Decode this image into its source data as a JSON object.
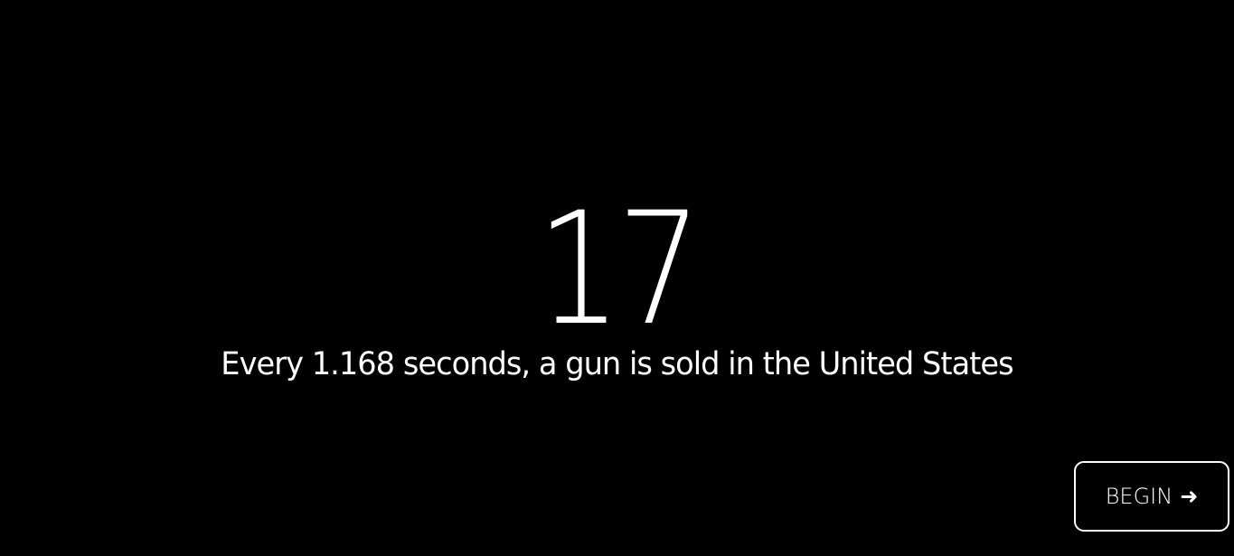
{
  "counter": {
    "value": "17"
  },
  "statement": {
    "text": "Every 1.168 seconds, a gun is sold in the United States"
  },
  "begin_button": {
    "label": "BEGIN",
    "arrow": "➜",
    "icon": "arrow-right-icon"
  },
  "colors": {
    "background": "#000000",
    "foreground": "#ffffff"
  }
}
